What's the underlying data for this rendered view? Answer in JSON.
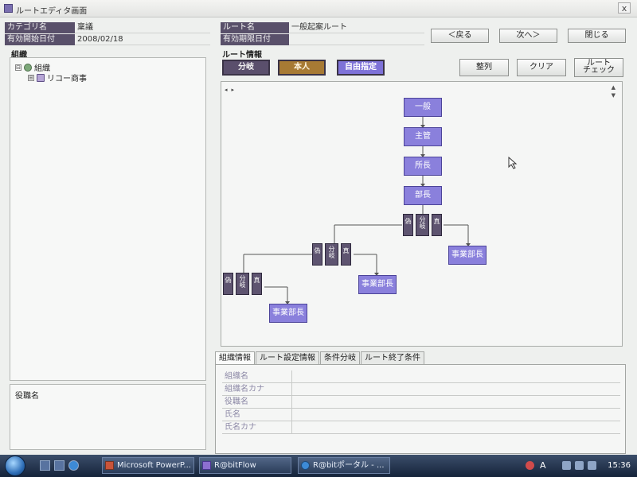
{
  "window": {
    "title": "ルートエディタ画面",
    "close_label": "x"
  },
  "header": {
    "category_label": "カテゴリ名",
    "category_value": "稟議",
    "valid_from_label": "有効開始日付",
    "valid_from_value": "2008/02/18",
    "route_name_label": "ルート名",
    "route_name_value": "一般起案ルート",
    "valid_to_label": "有効期限日付",
    "valid_to_value": ""
  },
  "nav_buttons": {
    "back": "＜戻る",
    "next": "次へ＞",
    "close": "閉じる"
  },
  "org_panel": {
    "heading": "組織",
    "tree": [
      {
        "label": "組織",
        "expander": "⊟"
      },
      {
        "label": "リコー商事",
        "expander": "⊞"
      }
    ],
    "role_heading": "役職名"
  },
  "route_info": {
    "heading": "ルート情報",
    "modes": {
      "branch": "分岐",
      "self": "本人",
      "free": "自由指定"
    },
    "actions": {
      "align": "整列",
      "clear": "クリア",
      "check_line1": "ルート",
      "check_line2": "チェック"
    }
  },
  "flow": {
    "nodes": [
      "一般",
      "主管",
      "所長",
      "部長",
      "事業部長",
      "事業部長",
      "事業部長"
    ],
    "mini_proxy": "偽",
    "mini_split": "分岐",
    "mini_true": "真"
  },
  "tabs": [
    "組織情報",
    "ルート設定情報",
    "条件分岐",
    "ルート終了条件"
  ],
  "org_info_fields": [
    "組織名",
    "組織名カナ",
    "役職名",
    "氏名",
    "氏名カナ"
  ],
  "taskbar": {
    "tasks": [
      "Microsoft PowerP...",
      "R@bitFlow",
      "R@bitポータル - ..."
    ],
    "ime": "A",
    "clock": "15:36"
  },
  "colors": {
    "label_bg": "#59506a",
    "node_bg": "#8a80dc",
    "split_bg": "#5e5470",
    "self_btn": "#a77a34"
  }
}
